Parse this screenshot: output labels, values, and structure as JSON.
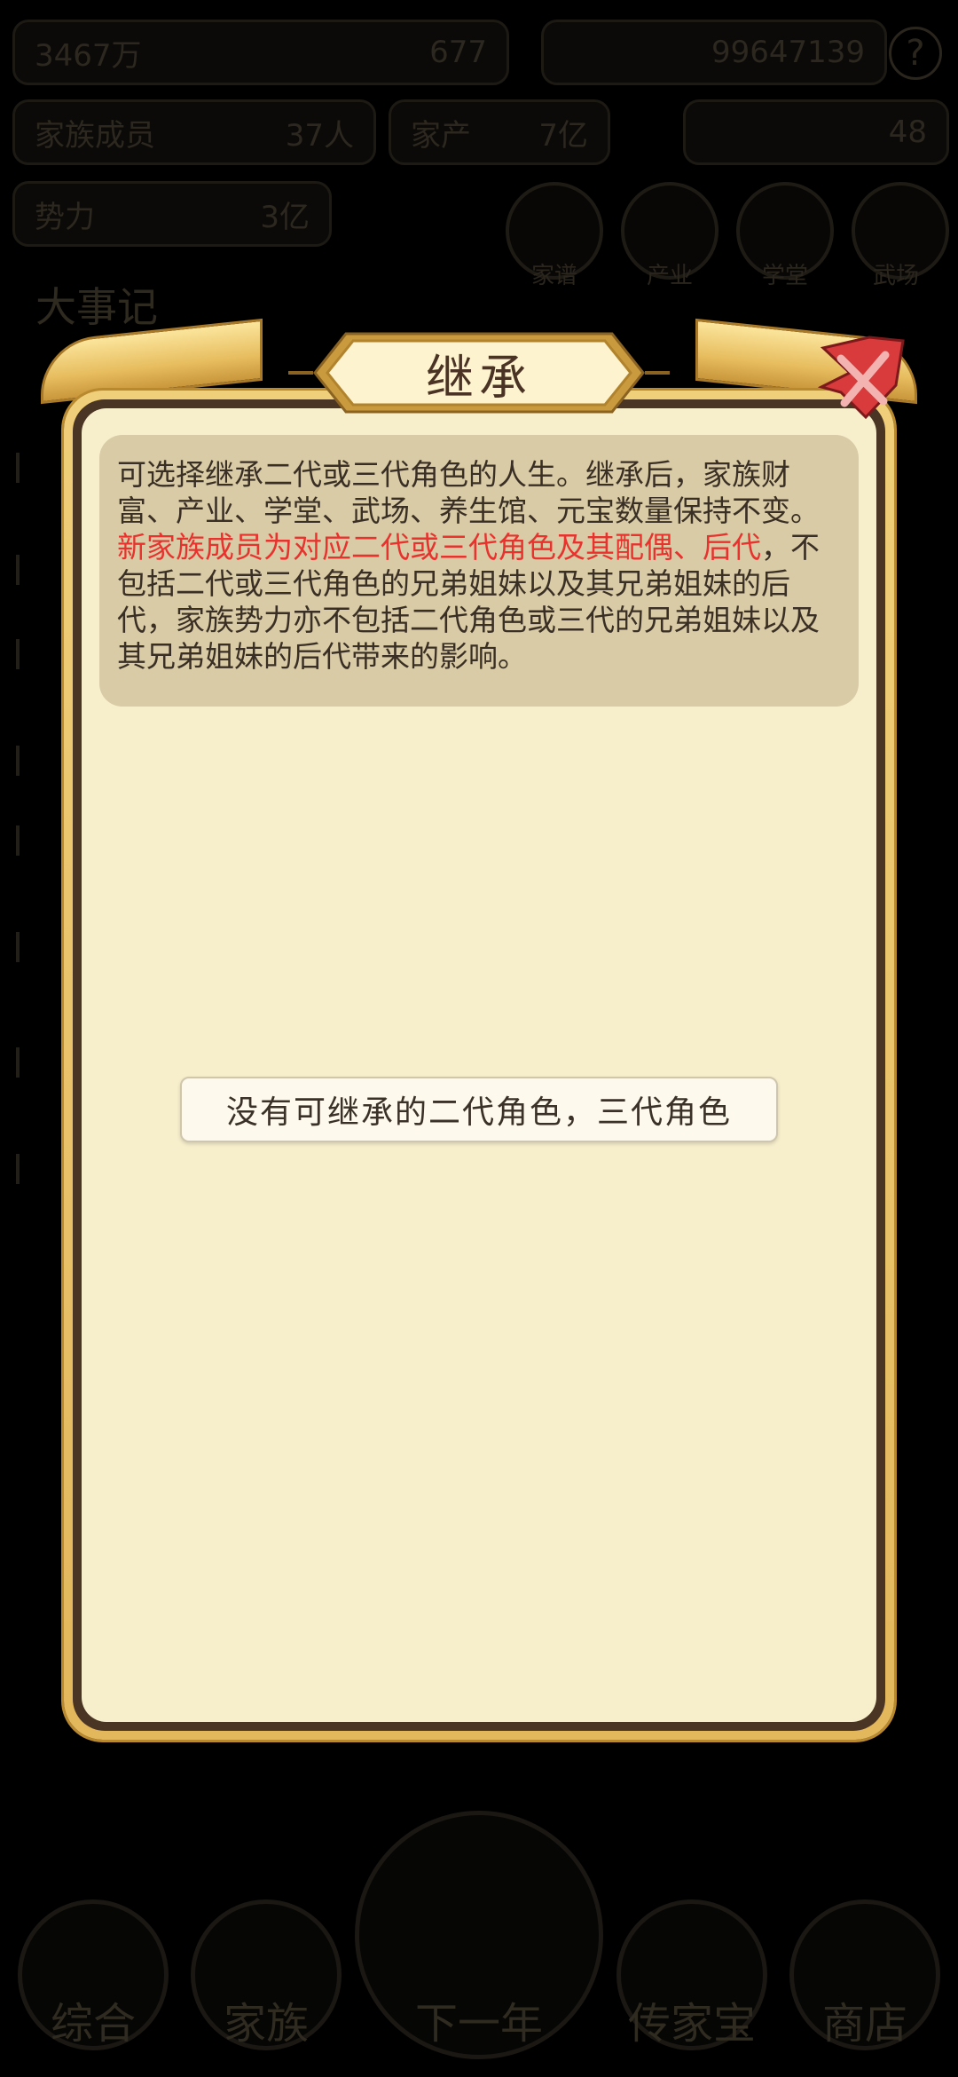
{
  "background": {
    "top_stat_left": "3467万",
    "top_stat_left_value": "677",
    "top_stat_right_value": "99647139",
    "stat_family_label": "家族成员",
    "stat_family_value": "37人",
    "stat_wealth_label": "家产",
    "stat_wealth_value": "7亿",
    "stat_gold_value": "48",
    "stat_power_label": "势力",
    "stat_power_value": "3亿",
    "icon_labels": [
      "家谱",
      "产业",
      "学堂",
      "武场"
    ],
    "event_title": "大事记",
    "bottom_nav": [
      "综合",
      "家族",
      "下一年",
      "传家宝",
      "商店"
    ]
  },
  "dialog": {
    "title": "继承",
    "desc_part1": "可选择继承二代或三代角色的人生。继承后，家族财富、产业、学堂、武场、养生馆、元宝数量保持不变。",
    "desc_highlight": "新家族成员为对应二代或三代角色及其配偶、后代",
    "desc_part2": "，不包括二代或三代角色的兄弟姐妹以及其兄弟姐妹的后代，家族势力亦不包括二代角色或三代的兄弟姐妹以及其兄弟姐妹的后代带来的影响。",
    "empty_message": "没有可继承的二代角色，三代角色"
  },
  "colors": {
    "highlight": "#e8322e",
    "panel": "#f7efcc",
    "frame_gold": "#e3b75c",
    "close_red": "#d93a3c"
  }
}
